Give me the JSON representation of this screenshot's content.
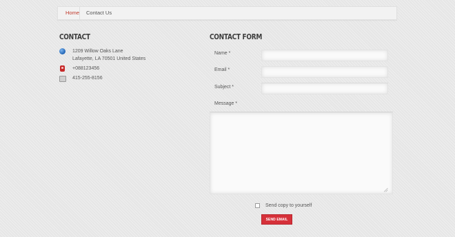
{
  "breadcrumb": {
    "home": "Home",
    "current": "Contact Us"
  },
  "contact": {
    "heading": "CONTACT",
    "address_line1": "1209 Willow Oaks Lane",
    "address_line2": "Lafayette, LA 70501 United States",
    "phone": "+088123456",
    "fax": "415-255-8156",
    "icons": {
      "address": "globe-icon",
      "phone": "mobile-phone-icon",
      "fax": "fax-icon"
    }
  },
  "form": {
    "heading": "CONTACT FORM",
    "name_label": "Name *",
    "email_label": "Email *",
    "subject_label": "Subject *",
    "message_label": "Message *",
    "name_value": "",
    "email_value": "",
    "subject_value": "",
    "message_value": "",
    "copy_label": "Send copy to yourself",
    "send_label": "SEND EMAIL"
  },
  "colors": {
    "accent": "#d6313a",
    "link": "#c0392b",
    "background": "#e6e6e6"
  }
}
